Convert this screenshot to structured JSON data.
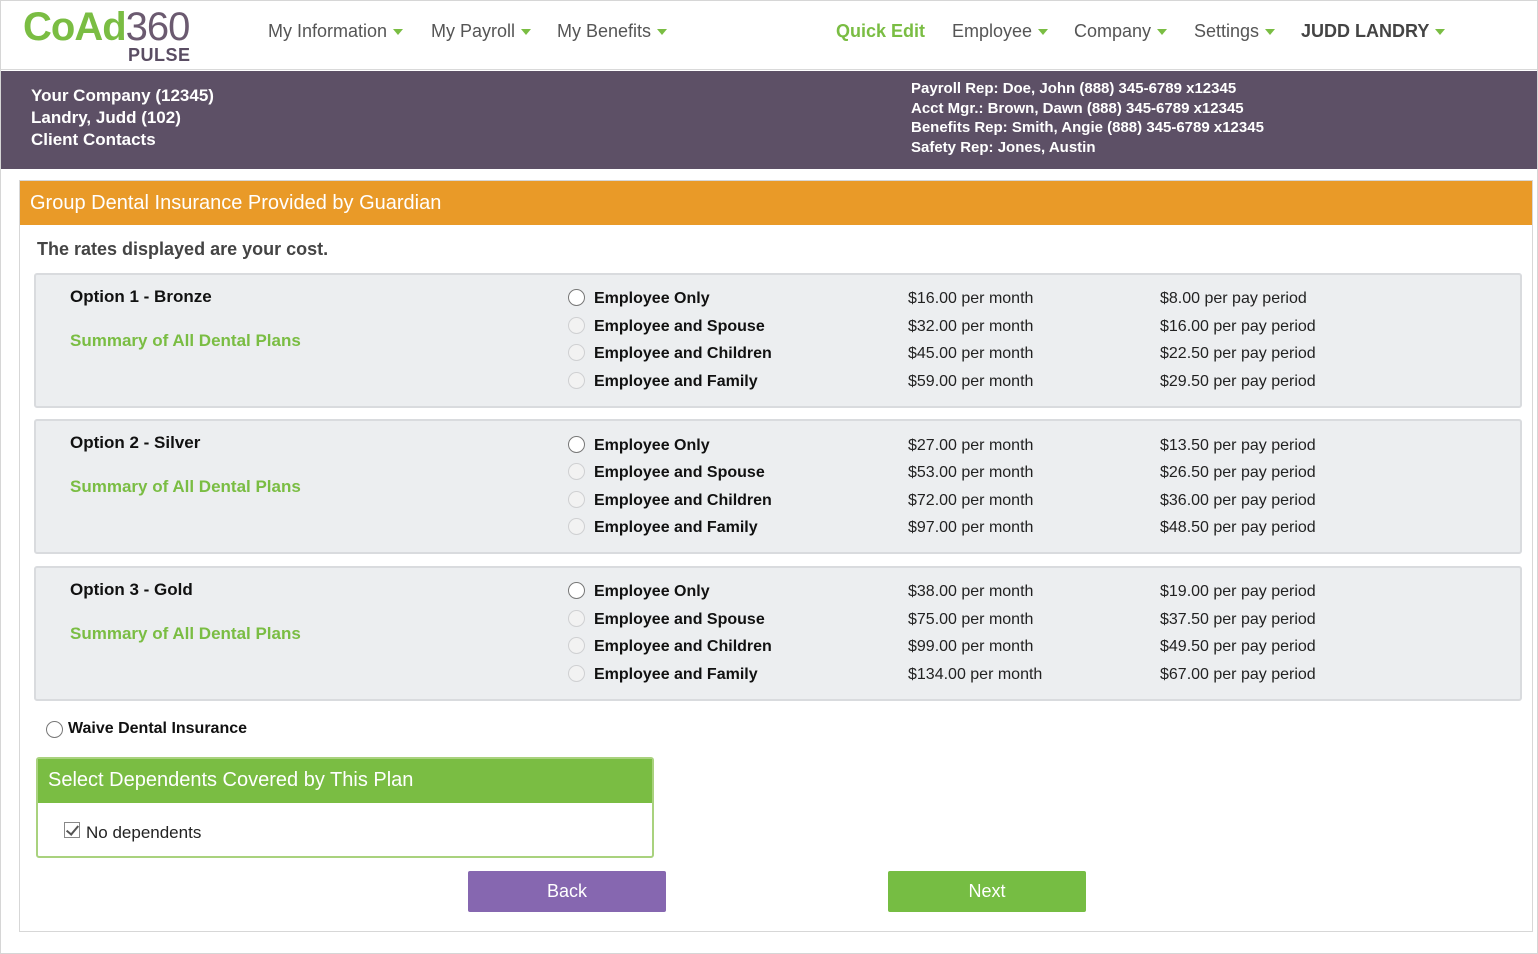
{
  "app": {
    "logo_main_a": "CoAd",
    "logo_main_b": "360",
    "logo_sub": "PULSE"
  },
  "nav": {
    "my_information": "My Information",
    "my_payroll": "My Payroll",
    "my_benefits": "My Benefits",
    "quick_edit": "Quick Edit",
    "employee": "Employee",
    "company": "Company",
    "settings": "Settings",
    "user": "JUDD LANDRY"
  },
  "header": {
    "company": "Your Company (12345)",
    "employee": "Landry, Judd (102)",
    "client_contacts": "Client Contacts",
    "payroll_rep": "Payroll Rep: Doe, John (888) 345-6789 x12345",
    "acct_mgr": "Acct Mgr.: Brown, Dawn (888) 345-6789 x12345",
    "benefits_rep": "Benefits Rep: Smith, Angie (888) 345-6789 x12345",
    "safety_rep": "Safety Rep: Jones, Austin"
  },
  "plan": {
    "title": "Group Dental Insurance Provided by Guardian",
    "rates_note": "The rates displayed are your cost.",
    "summary_link": "Summary of All Dental Plans",
    "options": [
      {
        "name": "Option 1 - Bronze",
        "rows": [
          {
            "coverage": "Employee Only",
            "monthly": "$16.00 per month",
            "per_period": "$8.00 per pay period"
          },
          {
            "coverage": "Employee and Spouse",
            "monthly": "$32.00 per month",
            "per_period": "$16.00 per pay period"
          },
          {
            "coverage": "Employee and Children",
            "monthly": "$45.00 per month",
            "per_period": "$22.50 per pay period"
          },
          {
            "coverage": "Employee and Family",
            "monthly": "$59.00 per month",
            "per_period": "$29.50 per pay period"
          }
        ]
      },
      {
        "name": "Option 2 - Silver",
        "rows": [
          {
            "coverage": "Employee Only",
            "monthly": "$27.00 per month",
            "per_period": "$13.50 per pay period"
          },
          {
            "coverage": "Employee and Spouse",
            "monthly": "$53.00 per month",
            "per_period": "$26.50 per pay period"
          },
          {
            "coverage": "Employee and Children",
            "monthly": "$72.00 per month",
            "per_period": "$36.00 per pay period"
          },
          {
            "coverage": "Employee and Family",
            "monthly": "$97.00 per month",
            "per_period": "$48.50 per pay period"
          }
        ]
      },
      {
        "name": "Option 3 - Gold",
        "rows": [
          {
            "coverage": "Employee Only",
            "monthly": "$38.00 per month",
            "per_period": "$19.00 per pay period"
          },
          {
            "coverage": "Employee and Spouse",
            "monthly": "$75.00 per month",
            "per_period": "$37.50 per pay period"
          },
          {
            "coverage": "Employee and Children",
            "monthly": "$99.00 per month",
            "per_period": "$49.50 per pay period"
          },
          {
            "coverage": "Employee and Family",
            "monthly": "$134.00 per month",
            "per_period": "$67.00 per pay period"
          }
        ]
      }
    ],
    "waive_label": "Waive Dental Insurance"
  },
  "dependents": {
    "title": "Select Dependents Covered by This Plan",
    "no_dependents": "No dependents",
    "no_dependents_checked": true
  },
  "buttons": {
    "back": "Back",
    "next": "Next"
  },
  "colors": {
    "brand_green": "#7abd43",
    "brand_purple": "#5d5066",
    "plan_header_orange": "#e99a28",
    "back_button": "#8667b0"
  }
}
